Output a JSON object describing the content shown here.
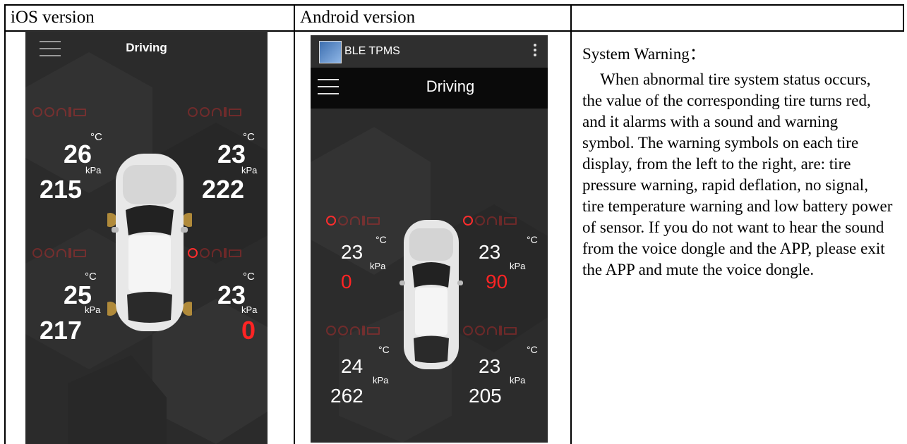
{
  "table": {
    "col_ios_header": "iOS version",
    "col_android_header": "Android version",
    "col_desc_header": ""
  },
  "ios": {
    "title": "Driving",
    "temp_unit": "°C",
    "pressure_unit": "kPa",
    "front_left": {
      "temp": "26",
      "pressure": "215"
    },
    "front_right": {
      "temp": "23",
      "pressure": "222"
    },
    "rear_left": {
      "temp": "25",
      "pressure": "217"
    },
    "rear_right": {
      "temp": "23",
      "pressure": "0"
    }
  },
  "android": {
    "app_name": "BLE TPMS",
    "title": "Driving",
    "temp_unit": "°C",
    "pressure_unit": "kPa",
    "front_left": {
      "temp": "23",
      "pressure": "0"
    },
    "front_right": {
      "temp": "23",
      "pressure": "90"
    },
    "rear_left": {
      "temp": "24",
      "pressure": "262"
    },
    "rear_right": {
      "temp": "23",
      "pressure": "205"
    }
  },
  "description": {
    "heading": "System Warning：",
    "body": "When abnormal tire system status occurs, the value of the corresponding tire turns red, and it alarms with a sound and warning symbol. The warning symbols on each tire display, from the left to the right, are: tire pressure warning, rapid deflation, no signal, tire temperature warning and low battery power of sensor. If you do not want to hear the sound from the voice dongle and the APP, please exit the APP and mute the voice dongle."
  },
  "colors": {
    "screen_bg": "#2b2b2b",
    "value_white": "#ffffff",
    "value_red": "#ff2424",
    "warning_red": "#ff2d2d",
    "android_bar": "#0a0a0a"
  },
  "icons": [
    "menu-icon",
    "overflow-menu-icon",
    "app-logo-icon",
    "tire-pressure-warning-icon",
    "rapid-deflation-icon",
    "no-signal-icon",
    "tire-temperature-warning-icon",
    "low-battery-icon",
    "car-image"
  ]
}
